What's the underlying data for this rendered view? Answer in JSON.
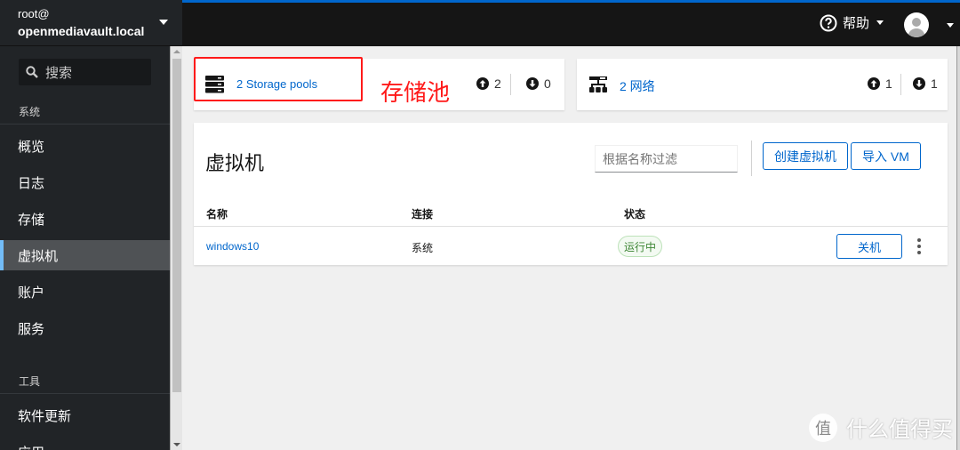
{
  "host": {
    "user": "root@",
    "hostname": "openmediavault.local"
  },
  "sidebar": {
    "search_placeholder": "搜索",
    "section_system": "系统",
    "items": [
      {
        "label": "概览"
      },
      {
        "label": "日志"
      },
      {
        "label": "存储"
      },
      {
        "label": "虚拟机",
        "active": true
      },
      {
        "label": "账户"
      },
      {
        "label": "服务"
      }
    ],
    "section_tools": "工具",
    "tool_items": [
      {
        "label": "软件更新"
      },
      {
        "label": "应用"
      }
    ]
  },
  "topbar": {
    "help_label": "帮助"
  },
  "cards": {
    "storage": {
      "label": "2 Storage pools",
      "up": "2",
      "down": "0",
      "icon": "server-stack-icon"
    },
    "network": {
      "label": "2 网络",
      "up": "1",
      "down": "1",
      "icon": "network-icon"
    }
  },
  "annotation": {
    "text": "存储池",
    "color": "#ff1a1a"
  },
  "vms": {
    "title": "虚拟机",
    "filter_placeholder": "根据名称过滤",
    "create_label": "创建虚拟机",
    "import_label": "导入 VM",
    "columns": [
      "名称",
      "连接",
      "状态"
    ],
    "rows": [
      {
        "name": "windows10",
        "connection": "系统",
        "status": "运行中",
        "action": "关机"
      }
    ]
  },
  "colors": {
    "accent": "#0066cc",
    "sidebar_bg": "#212427",
    "topbar_bg": "#151515",
    "active_indicator": "#73bcf7",
    "status_running": "#3e8635"
  },
  "watermark": {
    "logo": "值",
    "text": "什么值得买"
  }
}
